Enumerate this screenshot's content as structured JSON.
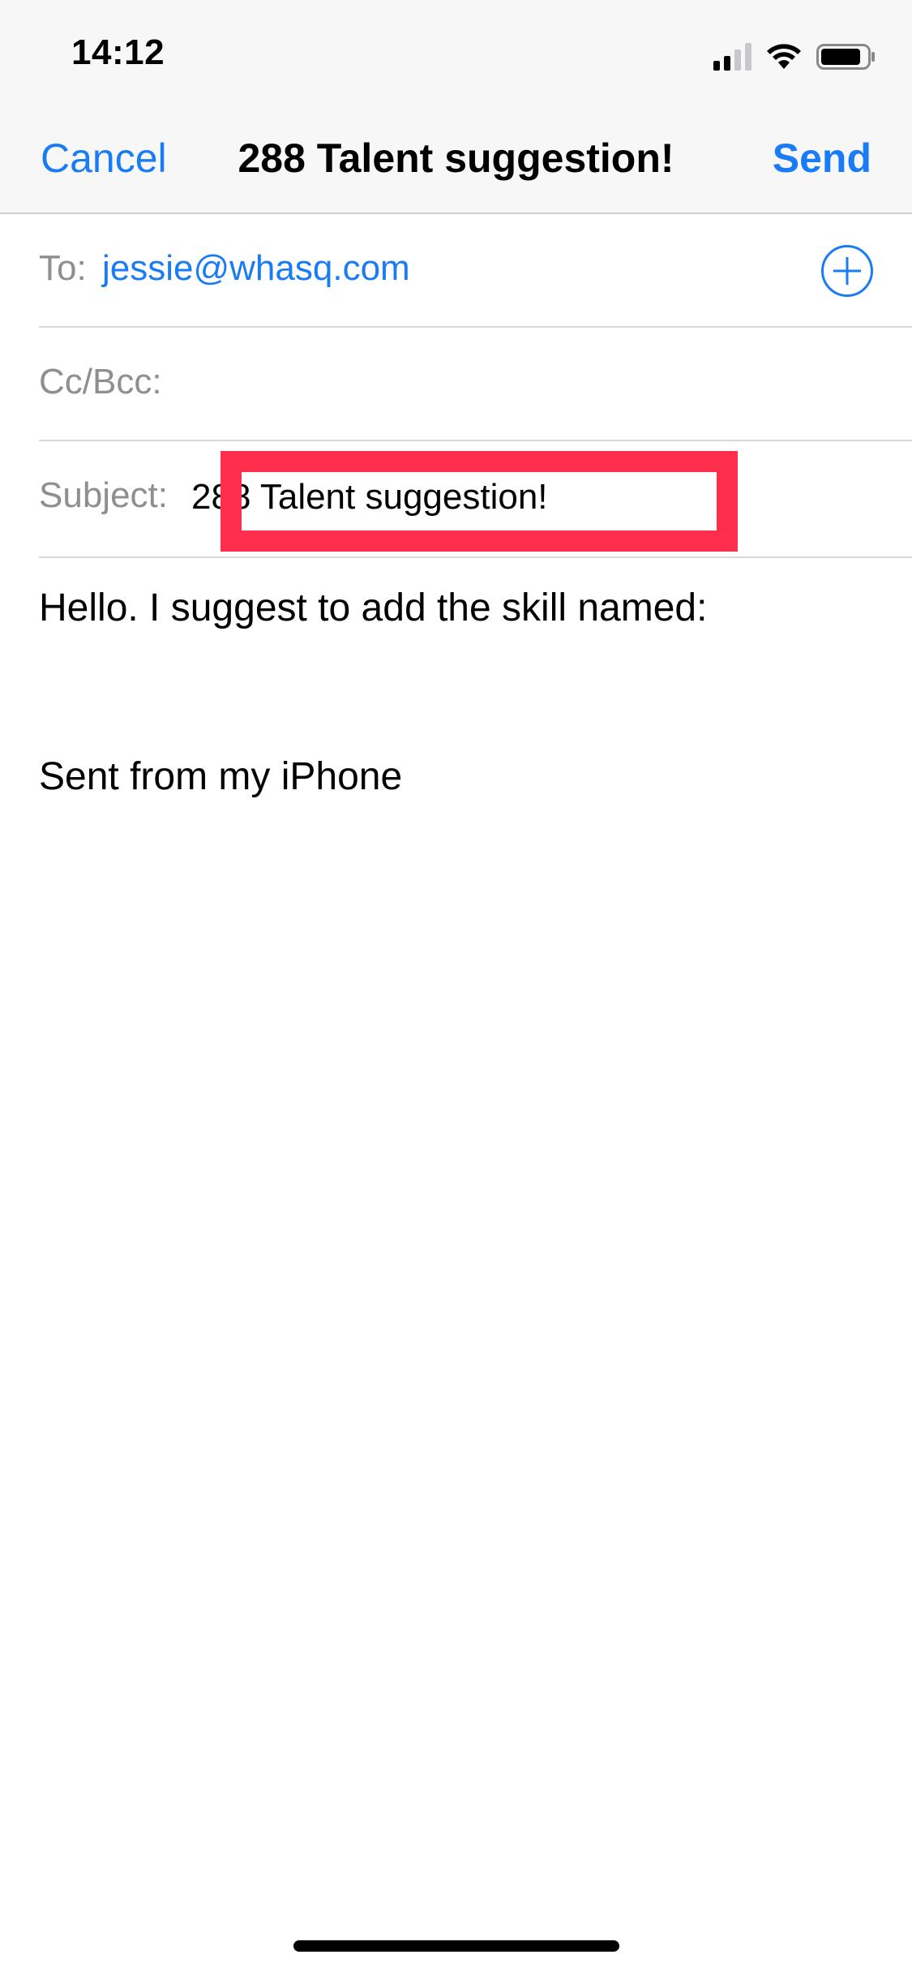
{
  "status_bar": {
    "time": "14:12"
  },
  "nav": {
    "cancel_label": "Cancel",
    "title": "288 Talent suggestion!",
    "send_label": "Send"
  },
  "fields": {
    "to_label": "To:",
    "to_value": "jessie@whasq.com",
    "cc_label": "Cc/Bcc:",
    "subject_label": "Subject:",
    "subject_value": "288 Talent suggestion!"
  },
  "body": {
    "text": "Hello. I suggest to add the skill named:",
    "signature": "Sent from my iPhone"
  },
  "icons": {
    "add_contact": "plus-circle-icon",
    "signal": "signal-icon",
    "wifi": "wifi-icon",
    "battery": "battery-icon"
  },
  "colors": {
    "accent": "#1a7cf5",
    "highlight": "#ff2e4c",
    "label_gray": "#8e8e93"
  }
}
